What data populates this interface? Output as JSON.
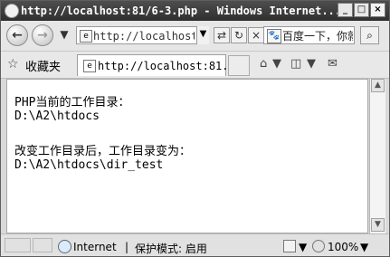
{
  "window": {
    "title": "http://localhost:81/6-3.php - Windows Internet...",
    "minimize": "_",
    "maximize": "□",
    "close": "×"
  },
  "nav": {
    "back_icon": "←",
    "forward_icon": "→",
    "dropdown_icon": "▼",
    "address": "http://localhost:8",
    "refresh_icon": "↻",
    "stop_icon": "×",
    "search_logo": "🐾",
    "search_text": "百度一下，你就",
    "search_icon": "⌕"
  },
  "favorites": {
    "star_icon": "☆",
    "label": "收藏夹",
    "tab_title": "http://localhost:81...",
    "home_icon": "⌂",
    "feed_icon": "◫",
    "mail_icon": "✉"
  },
  "page": {
    "line1": "PHP当前的工作目录：",
    "line2": "D:\\A2\\htdocs",
    "line3": "改变工作目录后，工作目录变为：",
    "line4": "D:\\A2\\htdocs\\dir_test"
  },
  "status": {
    "zone": "Internet",
    "separator": "|",
    "mode": "保护模式: 启用",
    "zoom": "100%"
  }
}
